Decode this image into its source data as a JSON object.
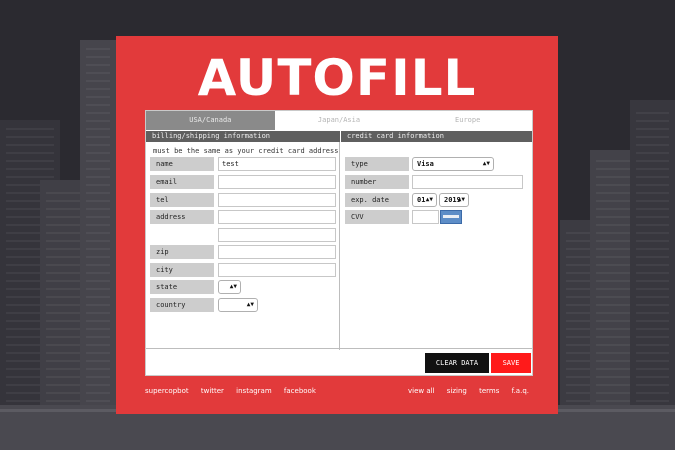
{
  "logo": "AUTOFILL",
  "tabs": [
    {
      "label": "USA/Canada"
    },
    {
      "label": "Japan/Asia"
    },
    {
      "label": "Europe"
    }
  ],
  "sections": {
    "billing": "billing/shipping information",
    "card": "credit card information"
  },
  "billing": {
    "note": "must be the same as your credit card address",
    "name_label": "name",
    "name_value": "test",
    "email_label": "email",
    "tel_label": "tel",
    "address_label": "address",
    "zip_label": "zip",
    "city_label": "city",
    "state_label": "state",
    "country_label": "country"
  },
  "card": {
    "type_label": "type",
    "type_value": "Visa",
    "number_label": "number",
    "exp_label": "exp. date",
    "exp_month": "01",
    "exp_year": "2019",
    "cvv_label": "CVV"
  },
  "buttons": {
    "clear": "CLEAR DATA",
    "save": "SAVE"
  },
  "footer": {
    "left_links": [
      "supercopbot",
      "twitter",
      "instagram",
      "facebook"
    ],
    "right_links": [
      "view all",
      "sizing",
      "terms",
      "f.a.q."
    ]
  },
  "colors": {
    "panel": "#e23a3b",
    "save_button": "#ff1a1a",
    "clear_button": "#111111"
  },
  "icons": {
    "select_arrow": "up-down-arrows",
    "cvv_card": "credit-card-icon"
  }
}
